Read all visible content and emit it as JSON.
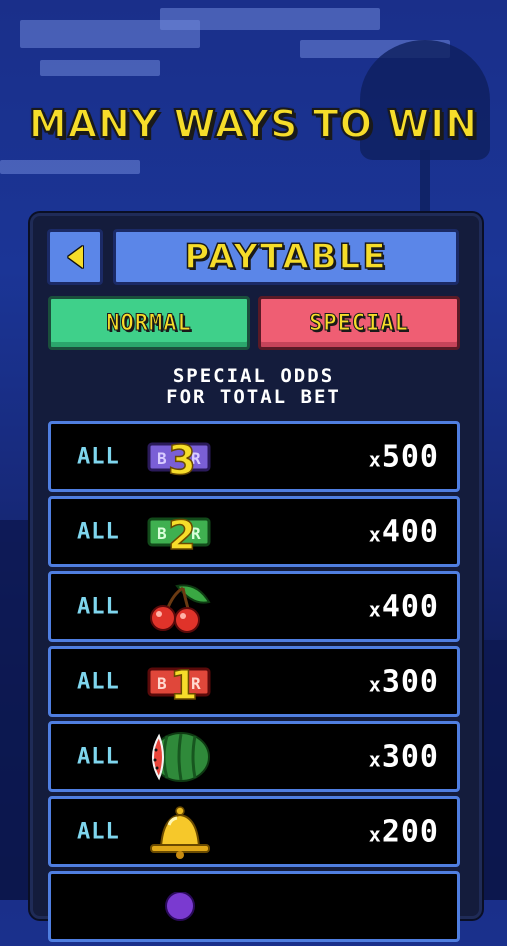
{
  "header": {
    "headline": "MANY WAYS TO WIN"
  },
  "panel": {
    "title": "PAYTABLE",
    "tabs": [
      {
        "label": "NORMAL",
        "active": false
      },
      {
        "label": "SPECIAL",
        "active": true
      }
    ],
    "subtitle_line1": "SPECIAL ODDS",
    "subtitle_line2": "FOR TOTAL BET"
  },
  "paytable": [
    {
      "prefix": "ALL",
      "symbol": "triple-bar-icon",
      "multiplier": "500"
    },
    {
      "prefix": "ALL",
      "symbol": "double-bar-icon",
      "multiplier": "400"
    },
    {
      "prefix": "ALL",
      "symbol": "cherry-icon",
      "multiplier": "400"
    },
    {
      "prefix": "ALL",
      "symbol": "single-bar-icon",
      "multiplier": "300"
    },
    {
      "prefix": "ALL",
      "symbol": "watermelon-icon",
      "multiplier": "300"
    },
    {
      "prefix": "ALL",
      "symbol": "bell-icon",
      "multiplier": "200"
    },
    {
      "prefix": "",
      "symbol": "plum-icon",
      "multiplier": ""
    }
  ],
  "colors": {
    "title_yellow": "#f6dd2a",
    "normal_tab": "#3fd08a",
    "special_tab": "#ef5e73",
    "row_border": "#4f7ee0",
    "all_text": "#7fd6ee"
  }
}
